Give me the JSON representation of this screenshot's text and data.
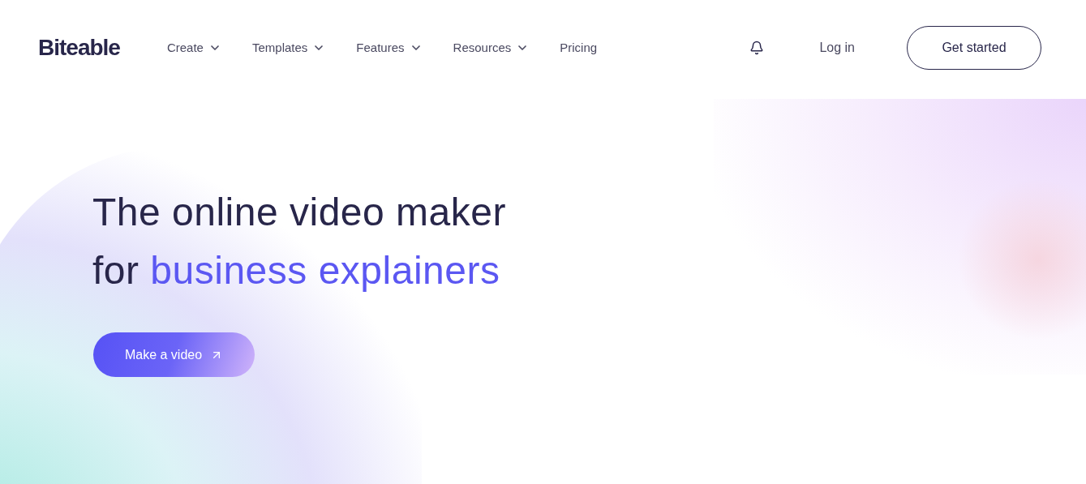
{
  "logo": "Biteable",
  "nav": [
    {
      "label": "Create",
      "has_dropdown": true
    },
    {
      "label": "Templates",
      "has_dropdown": true
    },
    {
      "label": "Features",
      "has_dropdown": true
    },
    {
      "label": "Resources",
      "has_dropdown": true
    },
    {
      "label": "Pricing",
      "has_dropdown": false
    }
  ],
  "login": "Log in",
  "cta_header": "Get started",
  "headline": {
    "line_1": "The online video maker",
    "line_2_plain": "for",
    "line_2_highlight": "business explainers"
  },
  "cta_hero": "Make a video"
}
